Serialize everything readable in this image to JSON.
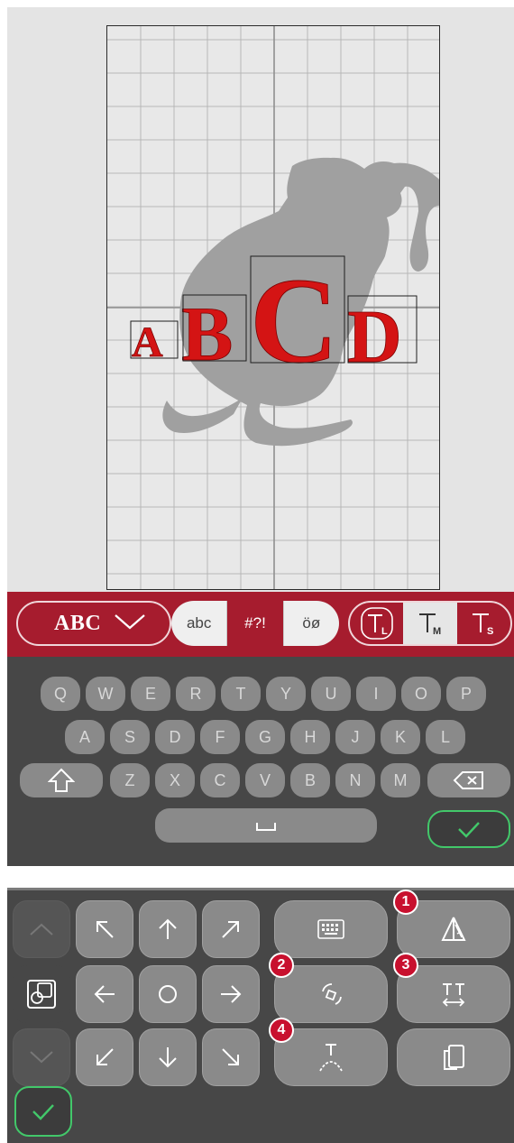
{
  "design": {
    "letters": [
      "A",
      "B",
      "C",
      "D"
    ],
    "letter_color": "#d41414",
    "motif": "cat-silhouette"
  },
  "toolbar": {
    "font_name": "ABC",
    "charsets": [
      "abc",
      "#?!",
      "öø"
    ],
    "active_charset": "#?!",
    "sizes": [
      "L",
      "M",
      "S"
    ],
    "active_size": "M",
    "accent_color": "#a61c2e"
  },
  "keyboard": {
    "row1": [
      "Q",
      "W",
      "E",
      "R",
      "T",
      "Y",
      "U",
      "I",
      "O",
      "P"
    ],
    "row2": [
      "A",
      "S",
      "D",
      "F",
      "G",
      "H",
      "J",
      "K",
      "L"
    ],
    "row3": [
      "Z",
      "X",
      "C",
      "V",
      "B",
      "N",
      "M"
    ],
    "ok_color": "#42c86a"
  },
  "edit_panel": {
    "callouts": [
      "1",
      "2",
      "3",
      "4"
    ],
    "icons": [
      "chevron-up-icon",
      "arrow-up-left-icon",
      "arrow-up-icon",
      "arrow-up-right-icon",
      "keyboard-icon",
      "mirror-icon",
      "resize-icon",
      "arrow-left-icon",
      "center-icon",
      "arrow-right-icon",
      "rotate-icon",
      "spacing-icon",
      "chevron-down-icon",
      "arrow-down-left-icon",
      "arrow-down-icon",
      "arrow-down-right-icon",
      "curve-text-icon",
      "duplicate-icon",
      "confirm-icon"
    ]
  }
}
